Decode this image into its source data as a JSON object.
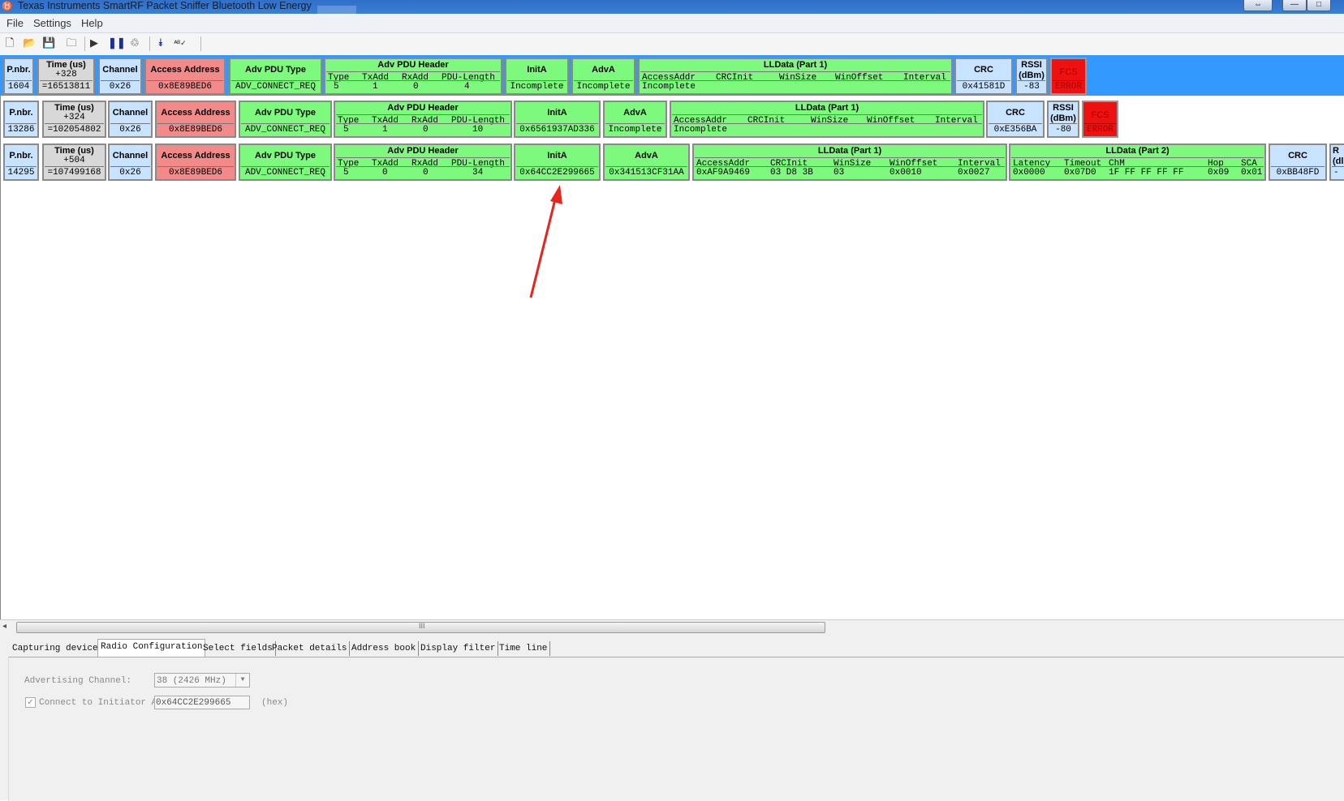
{
  "window": {
    "title": "Texas Instruments SmartRF Packet Sniffer Bluetooth Low Energy"
  },
  "menu": [
    "File",
    "Settings",
    "Help"
  ],
  "toolbar": {
    "icons": [
      "new-file-icon",
      "open-folder-icon",
      "save-icon",
      "folder-icon",
      "play-icon",
      "pause-icon",
      "clear-icon",
      "autoscroll-icon",
      "spellcheck-icon"
    ]
  },
  "labels": {
    "pnbr": "P.nbr.",
    "time": "Time (us)",
    "channel": "Channel",
    "access_address": "Access Address",
    "adv_pdu_type": "Adv PDU Type",
    "adv_pdu_header": "Adv PDU Header",
    "inita": "InitA",
    "adva": "AdvA",
    "lldata1": "LLData (Part 1)",
    "lldata2": "LLData (Part 2)",
    "crc": "CRC",
    "rssi": "RSSI (dBm)",
    "fcs": "FCS",
    "hdr_type": "Type",
    "hdr_txadd": "TxAdd",
    "hdr_rxadd": "RxAdd",
    "hdr_pdulen": "PDU-Length",
    "ll_accessaddr": "AccessAddr",
    "ll_crcinit": "CRCInit",
    "ll_winsize": "WinSize",
    "ll_winoffset": "WinOffset",
    "ll_interval": "Interval",
    "ll_latency": "Latency",
    "ll_timeout": "Timeout",
    "ll_chm": "ChM",
    "ll_hop": "Hop",
    "ll_sca": "SCA",
    "error": "ERROR",
    "cut_r": "R",
    "cut_dl": "(dl",
    "cut_dash": "-"
  },
  "packets": [
    {
      "pnbr": "1604",
      "time_delta": "+328",
      "time_abs": "=16513811",
      "channel": "0x26",
      "access_address": "0x8E89BED6",
      "adv_pdu_type": "ADV_CONNECT_REQ",
      "hdr": {
        "type": "5",
        "txadd": "1",
        "rxadd": "0",
        "pdulen": "4"
      },
      "inita": "Incomplete",
      "adva": "Incomplete",
      "lldata1": "Incomplete",
      "crc": "0x41581D",
      "rssi": "-83"
    },
    {
      "pnbr": "13286",
      "time_delta": "+324",
      "time_abs": "=102054802",
      "channel": "0x26",
      "access_address": "0x8E89BED6",
      "adv_pdu_type": "ADV_CONNECT_REQ",
      "hdr": {
        "type": "5",
        "txadd": "1",
        "rxadd": "0",
        "pdulen": "10"
      },
      "inita": "0x6561937AD336",
      "adva": "Incomplete",
      "lldata1": "Incomplete",
      "crc": "0xE356BA",
      "rssi": "-80"
    },
    {
      "pnbr": "14295",
      "time_delta": "+504",
      "time_abs": "=107499168",
      "channel": "0x26",
      "access_address": "0x8E89BED6",
      "adv_pdu_type": "ADV_CONNECT_REQ",
      "hdr": {
        "type": "5",
        "txadd": "0",
        "rxadd": "0",
        "pdulen": "34"
      },
      "inita": "0x64CC2E299665",
      "adva": "0x341513CF31AA",
      "ll1": {
        "accessaddr": "0xAF9A9469",
        "crcinit": "03 D8 3B",
        "winsize": "03",
        "winoffset": "0x0010",
        "interval": "0x0027"
      },
      "ll2": {
        "latency": "0x0000",
        "timeout": "0x07D0",
        "chm": "1F FF FF FF FF",
        "hop": "0x09",
        "sca": "0x01"
      },
      "crc": "0xBB48FD"
    }
  ],
  "scrollbar": {
    "grip": "III"
  },
  "tabs": [
    "Capturing device",
    "Radio Configuration",
    "Select fields",
    "Packet details",
    "Address book",
    "Display filter",
    "Time line"
  ],
  "active_tab": "Radio Configuration",
  "radio_config": {
    "adv_channel_label": "Advertising Channel:",
    "adv_channel_value": "38 (2426 MHz)",
    "connect_label": "Connect to Initiator Add",
    "connect_checked": true,
    "initiator_address": "0x64CC2E299665",
    "hex_label": "(hex)"
  },
  "annotations": {
    "color": "#e8241b"
  },
  "colors": {
    "selected_row": "#3399ff",
    "green": "#7dfa7d",
    "red": "#f38a8a",
    "blue": "#c7e3ff",
    "error": "#ee1111"
  }
}
